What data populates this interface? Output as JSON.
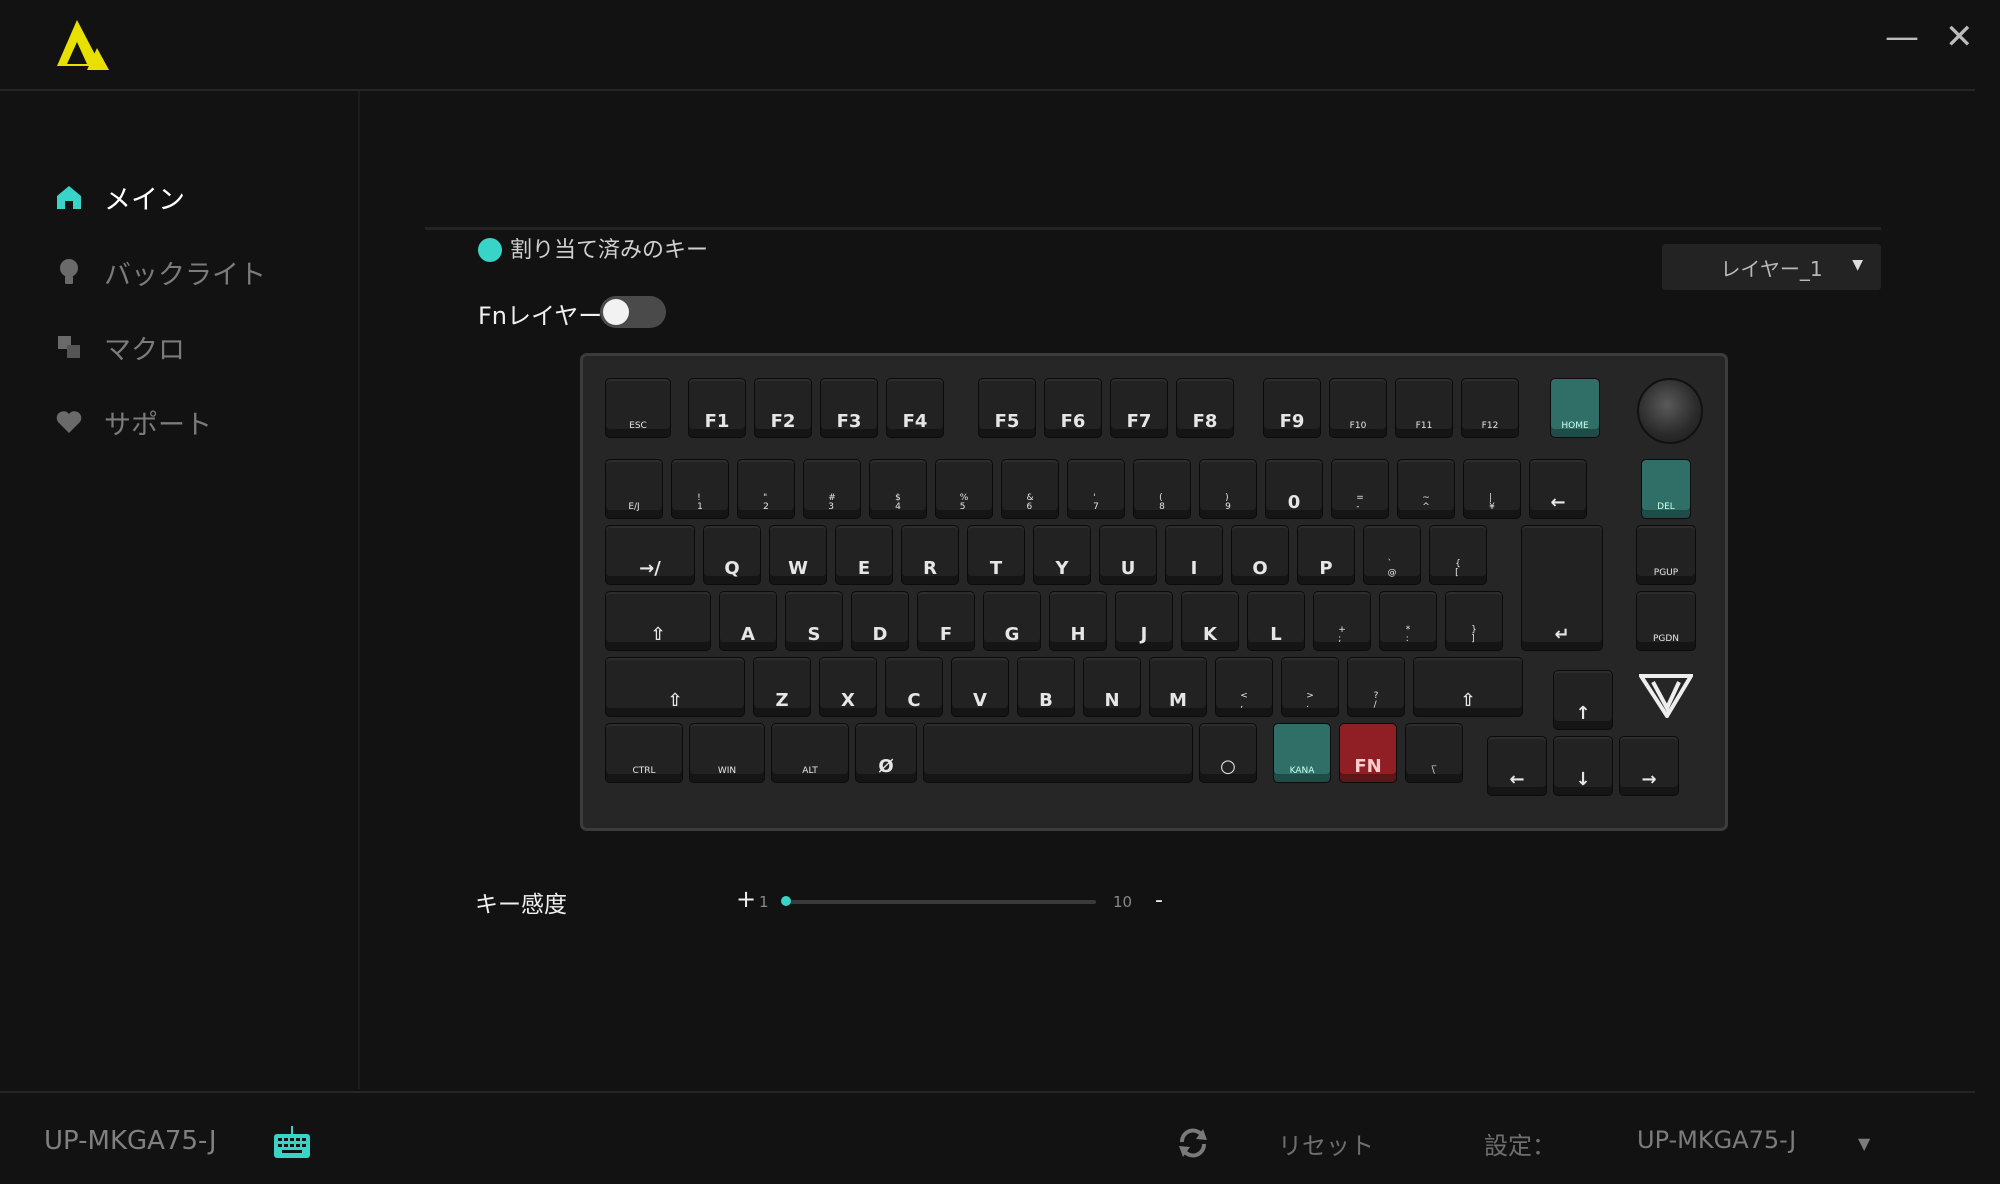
{
  "window": {
    "minimize_glyph": "—",
    "close_glyph": "✕"
  },
  "sidebar": {
    "items": [
      {
        "label": "メイン",
        "icon": "home-icon",
        "active": true
      },
      {
        "label": "バックライト",
        "icon": "bulb-icon",
        "active": false
      },
      {
        "label": "マクロ",
        "icon": "macro-icon",
        "active": false
      },
      {
        "label": "サポート",
        "icon": "heart-icon",
        "active": false
      }
    ]
  },
  "main": {
    "legend": "割り当て済みのキー",
    "legend_color": "#39d4c8",
    "layer_select": {
      "value": "レイヤー_1"
    },
    "fn_layer": {
      "label": "Fnレイヤー",
      "on": false
    },
    "sensitivity": {
      "label": "キー感度",
      "plus": "+",
      "min": "1",
      "max": "10",
      "minus": "-",
      "value": 1
    }
  },
  "keyboard": {
    "keys": [
      {
        "t": "ESC",
        "c": ""
      },
      {
        "t": "F1",
        "c": ""
      },
      {
        "t": "F2",
        "c": ""
      },
      {
        "t": "F3",
        "c": ""
      },
      {
        "t": "F4",
        "c": ""
      },
      {
        "t": "F5",
        "c": ""
      },
      {
        "t": "F6",
        "c": ""
      },
      {
        "t": "F7",
        "c": ""
      },
      {
        "t": "F8",
        "c": ""
      },
      {
        "t": "F9",
        "c": ""
      },
      {
        "t": "F10",
        "c": ""
      },
      {
        "t": "F11",
        "c": ""
      },
      {
        "t": "F12",
        "c": ""
      },
      {
        "t": "HOME",
        "c": "teal"
      },
      {
        "t": "E/J",
        "c": ""
      },
      {
        "t": "!\n1",
        "c": ""
      },
      {
        "t": "\"\n2",
        "c": ""
      },
      {
        "t": "#\n3",
        "c": ""
      },
      {
        "t": "$\n4",
        "c": ""
      },
      {
        "t": "%\n5",
        "c": ""
      },
      {
        "t": "&\n6",
        "c": ""
      },
      {
        "t": "'\n7",
        "c": ""
      },
      {
        "t": "(\n8",
        "c": ""
      },
      {
        "t": ")\n9",
        "c": ""
      },
      {
        "t": "0",
        "c": ""
      },
      {
        "t": "=\n-",
        "c": ""
      },
      {
        "t": "~\n^",
        "c": ""
      },
      {
        "t": "|\n¥",
        "c": ""
      },
      {
        "t": "←",
        "c": ""
      },
      {
        "t": "DEL",
        "c": "teal"
      },
      {
        "t": "→/",
        "c": ""
      },
      {
        "t": "Q",
        "c": ""
      },
      {
        "t": "W",
        "c": ""
      },
      {
        "t": "E",
        "c": ""
      },
      {
        "t": "R",
        "c": ""
      },
      {
        "t": "T",
        "c": ""
      },
      {
        "t": "Y",
        "c": ""
      },
      {
        "t": "U",
        "c": ""
      },
      {
        "t": "I",
        "c": ""
      },
      {
        "t": "O",
        "c": ""
      },
      {
        "t": "P",
        "c": ""
      },
      {
        "t": "`\n@",
        "c": ""
      },
      {
        "t": "{\n[",
        "c": ""
      },
      {
        "t": "↵",
        "c": ""
      },
      {
        "t": "PGUP",
        "c": ""
      },
      {
        "t": "⇧",
        "c": ""
      },
      {
        "t": "A",
        "c": ""
      },
      {
        "t": "S",
        "c": ""
      },
      {
        "t": "D",
        "c": ""
      },
      {
        "t": "F",
        "c": ""
      },
      {
        "t": "G",
        "c": ""
      },
      {
        "t": "H",
        "c": ""
      },
      {
        "t": "J",
        "c": ""
      },
      {
        "t": "K",
        "c": ""
      },
      {
        "t": "L",
        "c": ""
      },
      {
        "t": "+\n;",
        "c": ""
      },
      {
        "t": "*\n:",
        "c": ""
      },
      {
        "t": "}\n]",
        "c": ""
      },
      {
        "t": "PGDN",
        "c": ""
      },
      {
        "t": "⇧",
        "c": ""
      },
      {
        "t": "Z",
        "c": ""
      },
      {
        "t": "X",
        "c": ""
      },
      {
        "t": "C",
        "c": ""
      },
      {
        "t": "V",
        "c": ""
      },
      {
        "t": "B",
        "c": ""
      },
      {
        "t": "N",
        "c": ""
      },
      {
        "t": "M",
        "c": ""
      },
      {
        "t": "<\n,",
        "c": ""
      },
      {
        "t": ">\n.",
        "c": ""
      },
      {
        "t": "?\n/",
        "c": ""
      },
      {
        "t": "⇧",
        "c": ""
      },
      {
        "t": "↑",
        "c": ""
      },
      {
        "t": "CTRL",
        "c": ""
      },
      {
        "t": "WIN",
        "c": ""
      },
      {
        "t": "ALT",
        "c": ""
      },
      {
        "t": "Ø",
        "c": ""
      },
      {
        "t": "",
        "c": ""
      },
      {
        "t": "○",
        "c": ""
      },
      {
        "t": "KANA",
        "c": "teal"
      },
      {
        "t": "FN",
        "c": "red"
      },
      {
        "t": "_\n\\",
        "c": ""
      },
      {
        "t": "←",
        "c": ""
      },
      {
        "t": "↓",
        "c": ""
      },
      {
        "t": "→",
        "c": ""
      }
    ]
  },
  "footer": {
    "device_name": "UP-MKGA75-J",
    "reset": "リセット",
    "settings_label": "設定：",
    "profile": "UP-MKGA75-J"
  }
}
